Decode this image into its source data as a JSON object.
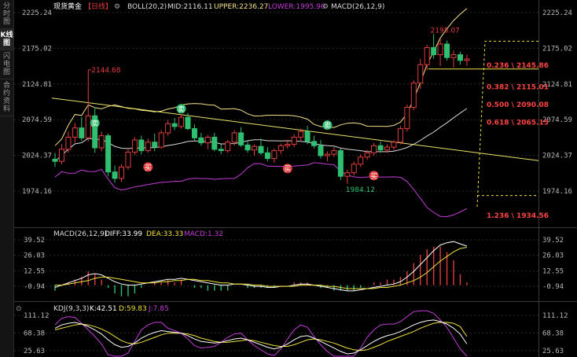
{
  "sidebar": {
    "items": [
      {
        "label": "分时图",
        "active": false
      },
      {
        "label": "K线图",
        "active": true
      },
      {
        "label": "闪电图",
        "active": false
      },
      {
        "label": "合约资料",
        "active": false
      }
    ]
  },
  "header": {
    "instrument": "现货黄金",
    "period": "【日线】",
    "boll": "BOLL(20,2)",
    "mid": "MID:2116.11",
    "upper": "UPPER:2236.27",
    "lower": "LOWER:1995.96",
    "macd": "MACD(26,12,9)"
  },
  "macd_header": {
    "name": "MACD(26,12,9)",
    "diff": "DIFF:33.99",
    "dea": "DEA:33.33",
    "macd": "MACD:1.32"
  },
  "kdj_header": {
    "name": "KDJ(9,3,3)",
    "k": "K:42.51",
    "d": "D:59.83",
    "j": "J:7.85"
  },
  "price_axis": [
    "2225.24",
    "2175.02",
    "2124.81",
    "2074.59",
    "2024.37",
    "1974.16"
  ],
  "macd_axis": [
    "39.52",
    "26.03",
    "12.55",
    "-0.94"
  ],
  "kdj_axis": [
    "111.12",
    "68.38",
    "25.63"
  ],
  "annotations": {
    "high_left": "2144.68",
    "high_right": "2195.07",
    "low": "1984.12"
  },
  "fib_levels": [
    {
      "label": "0.236 \\ 2145.86",
      "ratio": 0.236,
      "value": 2145.86
    },
    {
      "label": "0.382 \\ 2115.01",
      "ratio": 0.382,
      "value": 2115.01
    },
    {
      "label": "0.500 \\ 2090.08",
      "ratio": 0.5,
      "value": 2090.08
    },
    {
      "label": "0.618 \\ 2065.15",
      "ratio": 0.618,
      "value": 2065.15
    },
    {
      "label": "1.236 \\ 1934.56",
      "ratio": 1.236,
      "value": 1934.56
    }
  ],
  "signals": {
    "sell": "卖",
    "buy": "买"
  },
  "colors": {
    "up": "#e23d3d",
    "down": "#2fbf71",
    "mid": "#d8d8d8",
    "upper": "#f5e08a",
    "lower": "#c23dd6",
    "trend": "#e8e36a",
    "fib": "#f0e23c",
    "fib_label": "#ff4444",
    "diff": "#ffffff",
    "dea": "#f0e23c",
    "k": "#ffffff",
    "d": "#f0e23c",
    "j": "#c23dd6"
  },
  "chart_data": [
    {
      "type": "candlestick",
      "title": "现货黄金【日线】",
      "ylim": [
        1950,
        2240
      ],
      "yticks": [
        2225.24,
        2175.02,
        2124.81,
        2074.59,
        2024.37,
        1974.16
      ],
      "annotated_points": {
        "high_left": 2144.68,
        "high_right": 2195.07,
        "low": 1984.12
      },
      "ohlc": [
        [
          2019,
          2028,
          2008,
          2016
        ],
        [
          2016,
          2040,
          2012,
          2033
        ],
        [
          2033,
          2058,
          2028,
          2050
        ],
        [
          2050,
          2070,
          2042,
          2063
        ],
        [
          2063,
          2078,
          2045,
          2049
        ],
        [
          2049,
          2144.68,
          2044,
          2080
        ],
        [
          2080,
          2092,
          2028,
          2035
        ],
        [
          2035,
          2058,
          2030,
          2052
        ],
        [
          2052,
          2055,
          1995,
          2001
        ],
        [
          2001,
          2010,
          1986,
          1992
        ],
        [
          1992,
          2012,
          1987,
          2008
        ],
        [
          2008,
          2034,
          2004,
          2029
        ],
        [
          2029,
          2050,
          2025,
          2046
        ],
        [
          2046,
          2052,
          2026,
          2031
        ],
        [
          2031,
          2048,
          2028,
          2043
        ],
        [
          2043,
          2055,
          2030,
          2036
        ],
        [
          2036,
          2060,
          2034,
          2056
        ],
        [
          2056,
          2074,
          2052,
          2069
        ],
        [
          2069,
          2077,
          2060,
          2065
        ],
        [
          2065,
          2082,
          2062,
          2078
        ],
        [
          2078,
          2084,
          2060,
          2062
        ],
        [
          2062,
          2068,
          2044,
          2049
        ],
        [
          2049,
          2056,
          2038,
          2042
        ],
        [
          2042,
          2053,
          2033,
          2050
        ],
        [
          2050,
          2056,
          2030,
          2033
        ],
        [
          2033,
          2040,
          2026,
          2031
        ],
        [
          2031,
          2046,
          2028,
          2043
        ],
        [
          2043,
          2060,
          2038,
          2056
        ],
        [
          2056,
          2064,
          2036,
          2039
        ],
        [
          2039,
          2045,
          2028,
          2032
        ],
        [
          2032,
          2040,
          2024,
          2037
        ],
        [
          2037,
          2048,
          2025,
          2028
        ],
        [
          2028,
          2036,
          2016,
          2020
        ],
        [
          2020,
          2034,
          2014,
          2031
        ],
        [
          2031,
          2041,
          2026,
          2038
        ],
        [
          2038,
          2046,
          2034,
          2040
        ],
        [
          2040,
          2054,
          2036,
          2050
        ],
        [
          2050,
          2062,
          2044,
          2058
        ],
        [
          2058,
          2066,
          2040,
          2044
        ],
        [
          2044,
          2052,
          2034,
          2038
        ],
        [
          2038,
          2046,
          2020,
          2024
        ],
        [
          2024,
          2030,
          2016,
          2026
        ],
        [
          2026,
          2036,
          2022,
          2031
        ],
        [
          2031,
          2034,
          1990,
          1995
        ],
        [
          1995,
          2004,
          1984.12,
          2000
        ],
        [
          2000,
          2016,
          1996,
          2012
        ],
        [
          2012,
          2026,
          2008,
          2022
        ],
        [
          2022,
          2032,
          2018,
          2028
        ],
        [
          2028,
          2042,
          2024,
          2038
        ],
        [
          2038,
          2044,
          2028,
          2032
        ],
        [
          2032,
          2040,
          2028,
          2036
        ],
        [
          2036,
          2046,
          2032,
          2043
        ],
        [
          2043,
          2066,
          2040,
          2062
        ],
        [
          2062,
          2096,
          2058,
          2092
        ],
        [
          2092,
          2130,
          2088,
          2126
        ],
        [
          2126,
          2160,
          2118,
          2152
        ],
        [
          2152,
          2180,
          2144,
          2176
        ],
        [
          2176,
          2195.07,
          2160,
          2166
        ],
        [
          2166,
          2188,
          2150,
          2181
        ],
        [
          2181,
          2186,
          2158,
          2162
        ],
        [
          2162,
          2172,
          2148,
          2166
        ],
        [
          2166,
          2170,
          2152,
          2158
        ],
        [
          2158,
          2166,
          2150,
          2160
        ]
      ],
      "fib_levels": [
        2145.86,
        2115.01,
        2090.08,
        2065.15,
        1934.56
      ]
    },
    {
      "type": "bar",
      "title": "MACD(26,12,9)",
      "ylim": [
        -10,
        42
      ],
      "series": [
        {
          "name": "DIFF",
          "values": [
            -2,
            0,
            2,
            4,
            6,
            9,
            10,
            9,
            6,
            3,
            1,
            0,
            0,
            1,
            2,
            3,
            4,
            5,
            5,
            6,
            5,
            4,
            3,
            2,
            1,
            0,
            0,
            1,
            1,
            0,
            -1,
            -1,
            -2,
            -2,
            -1,
            -1,
            0,
            1,
            1,
            0,
            -1,
            -2,
            -3,
            -4,
            -5,
            -5,
            -4,
            -3,
            -2,
            -1,
            0,
            1,
            3,
            7,
            12,
            18,
            24,
            30,
            35,
            37,
            38,
            36,
            34
          ]
        },
        {
          "name": "DEA",
          "values": [
            0,
            0,
            1,
            2,
            3,
            4,
            6,
            7,
            7,
            6,
            5,
            4,
            3,
            2,
            2,
            2,
            3,
            3,
            4,
            4,
            5,
            5,
            4,
            4,
            3,
            2,
            2,
            1,
            1,
            1,
            0,
            0,
            -1,
            -1,
            -1,
            -1,
            -1,
            0,
            0,
            0,
            0,
            -1,
            -1,
            -2,
            -3,
            -3,
            -3,
            -3,
            -3,
            -2,
            -2,
            -1,
            0,
            2,
            4,
            7,
            11,
            16,
            21,
            25,
            29,
            32,
            33
          ]
        },
        {
          "name": "MACD",
          "values": [
            -4,
            0,
            2,
            4,
            6,
            10,
            8,
            4,
            -2,
            -6,
            -8,
            -8,
            -6,
            -2,
            0,
            2,
            2,
            4,
            2,
            4,
            0,
            -2,
            -2,
            -4,
            -4,
            -4,
            -4,
            0,
            0,
            -2,
            -2,
            -2,
            -2,
            -2,
            0,
            0,
            2,
            2,
            2,
            0,
            -2,
            -2,
            -4,
            -4,
            -4,
            -4,
            -2,
            0,
            2,
            2,
            4,
            4,
            6,
            10,
            16,
            22,
            26,
            28,
            28,
            24,
            18,
            8,
            2
          ]
        }
      ]
    },
    {
      "type": "line",
      "title": "KDJ(9,3,3)",
      "ylim": [
        0,
        125
      ],
      "series": [
        {
          "name": "K",
          "values": [
            80,
            88,
            92,
            94,
            90,
            84,
            76,
            66,
            52,
            40,
            34,
            36,
            44,
            56,
            64,
            70,
            74,
            72,
            70,
            68,
            62,
            54,
            48,
            46,
            44,
            46,
            50,
            54,
            56,
            52,
            46,
            40,
            34,
            30,
            34,
            42,
            52,
            60,
            62,
            56,
            48,
            40,
            32,
            24,
            18,
            20,
            28,
            38,
            48,
            56,
            62,
            66,
            72,
            80,
            88,
            94,
            98,
            100,
            96,
            90,
            80,
            66,
            42
          ]
        },
        {
          "name": "D",
          "values": [
            76,
            80,
            84,
            88,
            90,
            88,
            84,
            78,
            70,
            60,
            50,
            44,
            42,
            46,
            52,
            58,
            64,
            68,
            68,
            68,
            66,
            62,
            56,
            52,
            48,
            46,
            46,
            48,
            50,
            52,
            50,
            46,
            42,
            38,
            36,
            36,
            40,
            46,
            52,
            54,
            52,
            48,
            44,
            38,
            32,
            28,
            26,
            28,
            34,
            40,
            48,
            54,
            60,
            66,
            72,
            80,
            86,
            92,
            94,
            94,
            92,
            84,
            60
          ]
        },
        {
          "name": "J",
          "values": [
            88,
            104,
            108,
            106,
            92,
            76,
            60,
            42,
            16,
            2,
            2,
            20,
            48,
            76,
            88,
            94,
            94,
            80,
            74,
            68,
            54,
            38,
            32,
            34,
            36,
            46,
            58,
            66,
            68,
            52,
            38,
            28,
            18,
            14,
            30,
            54,
            76,
            88,
            82,
            60,
            40,
            24,
            8,
            -4,
            -10,
            4,
            32,
            58,
            76,
            88,
            90,
            90,
            96,
            108,
            120,
            122,
            122,
            116,
            100,
            82,
            56,
            30,
            8
          ]
        }
      ]
    }
  ]
}
